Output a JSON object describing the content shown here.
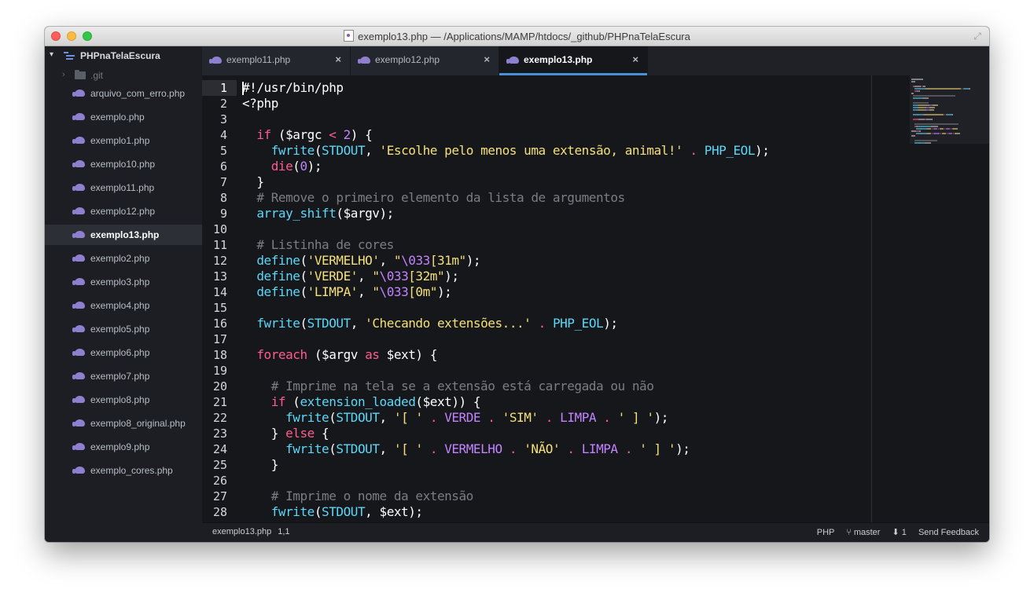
{
  "window": {
    "title": "exemplo13.php — /Applications/MAMP/htdocs/_github/PHPnaTelaEscura"
  },
  "sidebar": {
    "project": "PHPnaTelaEscura",
    "git_folder": ".git",
    "files": [
      "arquivo_com_erro.php",
      "exemplo.php",
      "exemplo1.php",
      "exemplo10.php",
      "exemplo11.php",
      "exemplo12.php",
      "exemplo13.php",
      "exemplo2.php",
      "exemplo3.php",
      "exemplo4.php",
      "exemplo5.php",
      "exemplo6.php",
      "exemplo7.php",
      "exemplo8.php",
      "exemplo8_original.php",
      "exemplo9.php",
      "exemplo_cores.php"
    ],
    "active_file": "exemplo13.php"
  },
  "tabs": [
    {
      "label": "exemplo11.php",
      "close": "×"
    },
    {
      "label": "exemplo12.php",
      "close": "×"
    },
    {
      "label": "exemplo13.php",
      "close": "×"
    }
  ],
  "editor": {
    "current_line": 1,
    "lines": [
      [
        [
          "t",
          "#!/usr/bin/php"
        ]
      ],
      [
        [
          "t",
          "<?php"
        ]
      ],
      [],
      [
        [
          "t",
          "  "
        ],
        [
          "kw",
          "if"
        ],
        [
          "t",
          " ($argc "
        ],
        [
          "op",
          "<"
        ],
        [
          "t",
          " "
        ],
        [
          "num",
          "2"
        ],
        [
          "t",
          ") {"
        ]
      ],
      [
        [
          "t",
          "    "
        ],
        [
          "fn",
          "fwrite"
        ],
        [
          "t",
          "("
        ],
        [
          "fn",
          "STDOUT"
        ],
        [
          "t",
          ", "
        ],
        [
          "st",
          "'Escolhe pelo menos uma extensão, animal!'"
        ],
        [
          "t",
          " "
        ],
        [
          "op",
          "."
        ],
        [
          "t",
          " "
        ],
        [
          "fn",
          "PHP_EOL"
        ],
        [
          "t",
          ");"
        ]
      ],
      [
        [
          "t",
          "    "
        ],
        [
          "kw",
          "die"
        ],
        [
          "t",
          "("
        ],
        [
          "num",
          "0"
        ],
        [
          "t",
          ");"
        ]
      ],
      [
        [
          "t",
          "  }"
        ]
      ],
      [
        [
          "t",
          "  "
        ],
        [
          "cm",
          "# Remove o primeiro elemento da lista de argumentos"
        ]
      ],
      [
        [
          "t",
          "  "
        ],
        [
          "fn",
          "array_shift"
        ],
        [
          "t",
          "($argv);"
        ]
      ],
      [],
      [
        [
          "t",
          "  "
        ],
        [
          "cm",
          "# Listinha de cores"
        ]
      ],
      [
        [
          "t",
          "  "
        ],
        [
          "fn",
          "define"
        ],
        [
          "t",
          "("
        ],
        [
          "st",
          "'VERMELHO'"
        ],
        [
          "t",
          ", "
        ],
        [
          "st",
          "\""
        ],
        [
          "num",
          "\\033"
        ],
        [
          "st",
          "[31m\""
        ],
        [
          "t",
          ");"
        ]
      ],
      [
        [
          "t",
          "  "
        ],
        [
          "fn",
          "define"
        ],
        [
          "t",
          "("
        ],
        [
          "st",
          "'VERDE'"
        ],
        [
          "t",
          ", "
        ],
        [
          "st",
          "\""
        ],
        [
          "num",
          "\\033"
        ],
        [
          "st",
          "[32m\""
        ],
        [
          "t",
          ");"
        ]
      ],
      [
        [
          "t",
          "  "
        ],
        [
          "fn",
          "define"
        ],
        [
          "t",
          "("
        ],
        [
          "st",
          "'LIMPA'"
        ],
        [
          "t",
          ", "
        ],
        [
          "st",
          "\""
        ],
        [
          "num",
          "\\033"
        ],
        [
          "st",
          "[0m\""
        ],
        [
          "t",
          ");"
        ]
      ],
      [],
      [
        [
          "t",
          "  "
        ],
        [
          "fn",
          "fwrite"
        ],
        [
          "t",
          "("
        ],
        [
          "fn",
          "STDOUT"
        ],
        [
          "t",
          ", "
        ],
        [
          "st",
          "'Checando extensões...'"
        ],
        [
          "t",
          " "
        ],
        [
          "op",
          "."
        ],
        [
          "t",
          " "
        ],
        [
          "fn",
          "PHP_EOL"
        ],
        [
          "t",
          ");"
        ]
      ],
      [],
      [
        [
          "t",
          "  "
        ],
        [
          "kw",
          "foreach"
        ],
        [
          "t",
          " ($argv "
        ],
        [
          "kw",
          "as"
        ],
        [
          "t",
          " $ext) {"
        ]
      ],
      [],
      [
        [
          "t",
          "    "
        ],
        [
          "cm",
          "# Imprime na tela se a extensão está carregada ou não"
        ]
      ],
      [
        [
          "t",
          "    "
        ],
        [
          "kw",
          "if"
        ],
        [
          "t",
          " ("
        ],
        [
          "fn",
          "extension_loaded"
        ],
        [
          "t",
          "($ext)) {"
        ]
      ],
      [
        [
          "t",
          "      "
        ],
        [
          "fn",
          "fwrite"
        ],
        [
          "t",
          "("
        ],
        [
          "fn",
          "STDOUT"
        ],
        [
          "t",
          ", "
        ],
        [
          "st",
          "'[ '"
        ],
        [
          "t",
          " "
        ],
        [
          "op",
          "."
        ],
        [
          "t",
          " "
        ],
        [
          "num",
          "VERDE"
        ],
        [
          "t",
          " "
        ],
        [
          "op",
          "."
        ],
        [
          "t",
          " "
        ],
        [
          "st",
          "'SIM'"
        ],
        [
          "t",
          " "
        ],
        [
          "op",
          "."
        ],
        [
          "t",
          " "
        ],
        [
          "num",
          "LIMPA"
        ],
        [
          "t",
          " "
        ],
        [
          "op",
          "."
        ],
        [
          "t",
          " "
        ],
        [
          "st",
          "' ] '"
        ],
        [
          "t",
          ");"
        ]
      ],
      [
        [
          "t",
          "    } "
        ],
        [
          "kw",
          "else"
        ],
        [
          "t",
          " {"
        ]
      ],
      [
        [
          "t",
          "      "
        ],
        [
          "fn",
          "fwrite"
        ],
        [
          "t",
          "("
        ],
        [
          "fn",
          "STDOUT"
        ],
        [
          "t",
          ", "
        ],
        [
          "st",
          "'[ '"
        ],
        [
          "t",
          " "
        ],
        [
          "op",
          "."
        ],
        [
          "t",
          " "
        ],
        [
          "num",
          "VERMELHO"
        ],
        [
          "t",
          " "
        ],
        [
          "op",
          "."
        ],
        [
          "t",
          " "
        ],
        [
          "st",
          "'NÃO'"
        ],
        [
          "t",
          " "
        ],
        [
          "op",
          "."
        ],
        [
          "t",
          " "
        ],
        [
          "num",
          "LIMPA"
        ],
        [
          "t",
          " "
        ],
        [
          "op",
          "."
        ],
        [
          "t",
          " "
        ],
        [
          "st",
          "' ] '"
        ],
        [
          "t",
          ");"
        ]
      ],
      [
        [
          "t",
          "    }"
        ]
      ],
      [],
      [
        [
          "t",
          "    "
        ],
        [
          "cm",
          "# Imprime o nome da extensão"
        ]
      ],
      [
        [
          "t",
          "    "
        ],
        [
          "fn",
          "fwrite"
        ],
        [
          "t",
          "("
        ],
        [
          "fn",
          "STDOUT"
        ],
        [
          "t",
          ", $ext);"
        ]
      ]
    ]
  },
  "status": {
    "file": "exemplo13.php",
    "position": "1,1",
    "syntax": "PHP",
    "branch_icon": "branch-icon",
    "branch": "master",
    "pull_icon": "arrow-down-icon",
    "behind": "1",
    "feedback": "Send Feedback"
  },
  "colors": {
    "keyword": "#ff5c8d",
    "function": "#5cd7f7",
    "string": "#f4e07a",
    "number": "#c383ff",
    "comment": "#7a7d83",
    "accent": "#4a8fd9"
  }
}
